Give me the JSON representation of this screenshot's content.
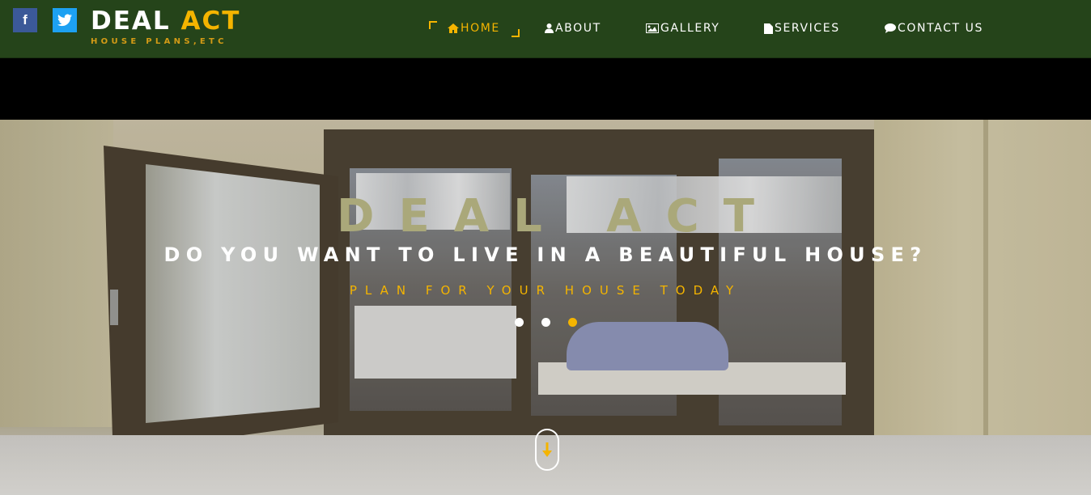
{
  "header": {
    "social": {
      "facebook": {
        "icon": "facebook-icon",
        "glyph": "f"
      },
      "twitter": {
        "icon": "twitter-icon",
        "glyph": "🐦"
      }
    },
    "logo": {
      "main_white": "DEAL ",
      "main_accent": "ACT",
      "subtitle": "HOUSE PLANS,ETC"
    },
    "nav": [
      {
        "label": "HOME",
        "icon": "home-icon",
        "glyph": "🏠",
        "active": true
      },
      {
        "label": "ABOUT",
        "icon": "user-icon",
        "glyph": "👤",
        "active": false
      },
      {
        "label": "GALLERY",
        "icon": "image-icon",
        "glyph": "🖼",
        "active": false
      },
      {
        "label": "SERVICES",
        "icon": "file-icon",
        "glyph": "📄",
        "active": false
      },
      {
        "label": "CONTACT US",
        "icon": "chat-icon",
        "glyph": "💬",
        "active": false
      }
    ]
  },
  "hero": {
    "title": "DEAL ACT",
    "subtitle": "DO YOU WANT TO LIVE IN A BEAUTIFUL HOUSE?",
    "tagline": "PLAN FOR YOUR HOUSE TODAY",
    "slides": {
      "count": 3,
      "active_index": 2
    },
    "scroll_button": {
      "icon": "arrow-down-icon",
      "glyph": "⬇"
    }
  },
  "colors": {
    "header_bg": "#25441a",
    "accent": "#f4b400",
    "hero_title": "#aaa87a"
  }
}
